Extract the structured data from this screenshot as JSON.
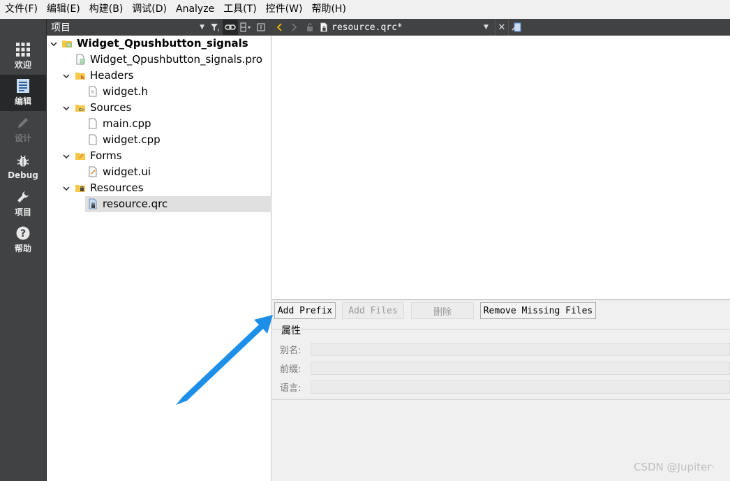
{
  "menubar": {
    "items": [
      "文件(F)",
      "编辑(E)",
      "构建(B)",
      "调试(D)",
      "Analyze",
      "工具(T)",
      "控件(W)",
      "帮助(H)"
    ]
  },
  "modes": [
    {
      "label": "欢迎",
      "icon": "grid-icon",
      "state": "normal"
    },
    {
      "label": "编辑",
      "icon": "document-icon",
      "state": "active"
    },
    {
      "label": "设计",
      "icon": "pencil-icon",
      "state": "disabled"
    },
    {
      "label": "Debug",
      "icon": "bug-icon",
      "state": "normal"
    },
    {
      "label": "项目",
      "icon": "wrench-icon",
      "state": "normal"
    },
    {
      "label": "帮助",
      "icon": "help-icon",
      "state": "normal"
    }
  ],
  "project_panel": {
    "title": "项目",
    "tree": [
      {
        "label": "Widget_Qpushbutton_signals",
        "icon": "project-folder-icon",
        "expanded": true,
        "bold": true
      },
      {
        "label": "Widget_Qpushbutton_signals.pro",
        "icon": "pro-file-icon"
      },
      {
        "label": "Headers",
        "icon": "headers-folder-icon",
        "expanded": true
      },
      {
        "label": "widget.h",
        "icon": "header-file-icon"
      },
      {
        "label": "Sources",
        "icon": "sources-folder-icon",
        "expanded": true
      },
      {
        "label": "main.cpp",
        "icon": "cpp-file-icon"
      },
      {
        "label": "widget.cpp",
        "icon": "cpp-file-icon"
      },
      {
        "label": "Forms",
        "icon": "forms-folder-icon",
        "expanded": true
      },
      {
        "label": "widget.ui",
        "icon": "ui-file-icon"
      },
      {
        "label": "Resources",
        "icon": "resources-folder-icon",
        "expanded": true
      },
      {
        "label": "resource.qrc",
        "icon": "qrc-file-icon",
        "selected": true
      }
    ]
  },
  "editor": {
    "document_title": "resource.qrc*"
  },
  "resource_editor": {
    "buttons": [
      {
        "label": "Add Prefix",
        "enabled": true
      },
      {
        "label": "Add Files",
        "enabled": false
      },
      {
        "label": "删除",
        "enabled": false
      },
      {
        "label": "Remove Missing Files",
        "enabled": true
      }
    ],
    "properties_title": "属性",
    "fields": [
      {
        "label": "别名:",
        "value": ""
      },
      {
        "label": "前缀:",
        "value": ""
      },
      {
        "label": "语言:",
        "value": ""
      }
    ]
  },
  "watermark": "CSDN @Jupiter·",
  "colors": {
    "sidebar_bg": "#404244",
    "sidebar_active": "#262829",
    "annotation_arrow": "#1e8fe8"
  }
}
